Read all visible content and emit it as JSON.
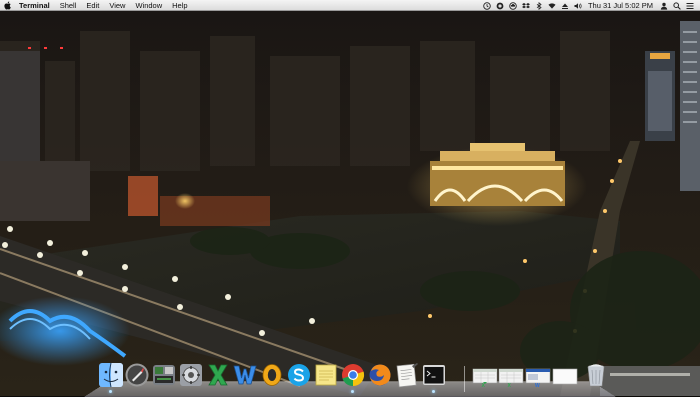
{
  "menubar": {
    "app_name": "Terminal",
    "menus": [
      "Shell",
      "Edit",
      "View",
      "Window",
      "Help"
    ],
    "clock": "Thu 31 Jul  5:02 PM",
    "status_icons": [
      "time-machine-icon",
      "clock-sync-icon",
      "cloud-icon",
      "dropbox-icon",
      "bluetooth-icon",
      "wifi-icon",
      "eject-icon",
      "volume-icon",
      "user-icon",
      "spotlight-icon",
      "list-icon"
    ]
  },
  "dock": {
    "apps": [
      {
        "name": "finder-icon"
      },
      {
        "name": "launchpad-icon"
      },
      {
        "name": "system-preferences-icon"
      },
      {
        "name": "network-utility-icon"
      },
      {
        "name": "excel-icon"
      },
      {
        "name": "word-icon"
      },
      {
        "name": "outlook-icon"
      },
      {
        "name": "skype-icon"
      },
      {
        "name": "stickies-icon"
      },
      {
        "name": "chrome-icon"
      },
      {
        "name": "firefox-icon"
      },
      {
        "name": "textedit-icon"
      },
      {
        "name": "terminal-icon"
      }
    ],
    "minimized": [
      {
        "name": "minimized-excel-window"
      },
      {
        "name": "minimized-excel-window-2"
      },
      {
        "name": "minimized-window"
      },
      {
        "name": "minimized-blank-window"
      },
      {
        "name": "trash-icon"
      }
    ]
  }
}
